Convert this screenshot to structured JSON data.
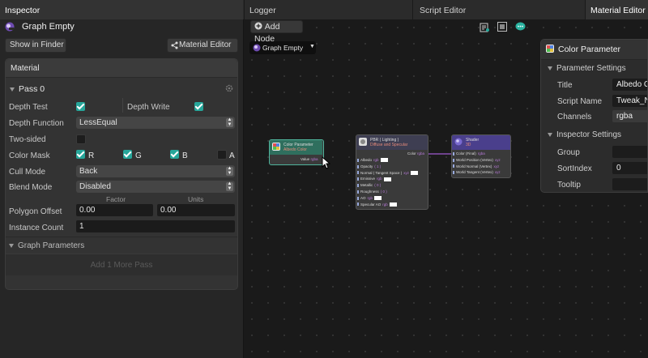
{
  "tabs": {
    "inspector": "Inspector",
    "logger": "Logger",
    "script_editor": "Script Editor",
    "material_editor": "Material Editor"
  },
  "inspector": {
    "title": "Graph Empty",
    "show_in_finder": "Show in Finder",
    "material_editor_button": "Material Editor",
    "section": "Material",
    "pass_label": "Pass 0",
    "depth_test": "Depth Test",
    "depth_write": "Depth Write",
    "depth_function": "Depth Function",
    "depth_function_value": "LessEqual",
    "two_sided": "Two-sided",
    "color_mask": "Color Mask",
    "mask_r": "R",
    "mask_g": "G",
    "mask_b": "B",
    "mask_a": "A",
    "cull_mode": "Cull Mode",
    "cull_mode_value": "Back",
    "blend_mode": "Blend Mode",
    "blend_mode_value": "Disabled",
    "factor_header": "Factor",
    "units_header": "Units",
    "polygon_offset": "Polygon Offset",
    "polygon_factor": "0.00",
    "polygon_units": "0.00",
    "instance_count": "Instance Count",
    "instance_count_value": "1",
    "graph_parameters": "Graph Parameters",
    "add_pass": "Add 1 More Pass"
  },
  "graph": {
    "add_node": "Add Node",
    "graph_selector": "Graph Empty",
    "nodes": {
      "color_param": {
        "title": "Color Parameter",
        "subtitle": "Albedo Color",
        "port": "Value",
        "port_type": "rgba"
      },
      "pbr": {
        "title": "PBR ( Lighting )",
        "subtitle": "Diffuse and Specular",
        "out_port": "Color",
        "out_type": "rgba",
        "inputs": [
          {
            "name": "Albedo",
            "type": "rgb"
          },
          {
            "name": "Opacity",
            "type": "( 1 )"
          },
          {
            "name": "Normal ( Tangent Space )",
            "type": "xyz"
          },
          {
            "name": "Emissive",
            "type": "rgb"
          },
          {
            "name": "Metallic",
            "type": "( 0 )"
          },
          {
            "name": "Roughness",
            "type": "( 0 )"
          },
          {
            "name": "AO",
            "type": "rgb"
          },
          {
            "name": "Specular AO",
            "type": "rgb"
          }
        ]
      },
      "shader": {
        "title": "Shader",
        "subtitle": "3D",
        "inputs": [
          {
            "name": "Color (Final)",
            "type": "rgba"
          },
          {
            "name": "World Position (Vertex)",
            "type": "xyz"
          },
          {
            "name": "World Normal (Vertex)",
            "type": "xyz"
          },
          {
            "name": "World Tangent (Vertex)",
            "type": "xyz"
          }
        ]
      }
    }
  },
  "properties": {
    "title": "Color Parameter",
    "parameter_settings": "Parameter Settings",
    "title_label": "Title",
    "title_value": "Albedo C",
    "script_name_label": "Script Name",
    "script_name_value": "Tweak_N",
    "channels_label": "Channels",
    "channels_value": "rgba",
    "inspector_settings": "Inspector Settings",
    "group_label": "Group",
    "group_value": "",
    "sort_index_label": "SortIndex",
    "sort_index_value": "0",
    "tooltip_label": "Tooltip",
    "tooltip_value": ""
  },
  "colors": {
    "accent": "#26a69a",
    "node_header_param": "#2f6f5e",
    "node_header_pbr": "#3e3e52",
    "node_header_shader": "#4a3f8c",
    "wire": "#a15bd1"
  }
}
